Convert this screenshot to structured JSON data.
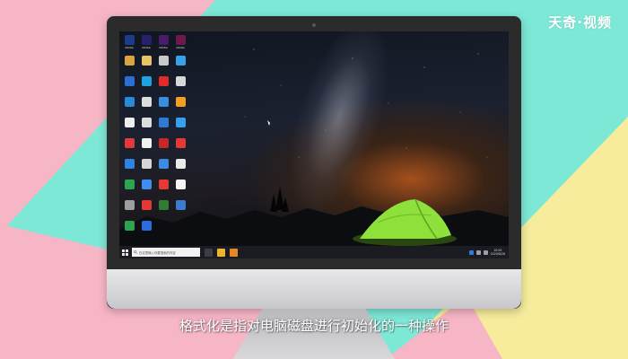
{
  "watermark": "天奇·视频",
  "caption": "格式化是指对电脑磁盘进行初始化的一种操作",
  "desktop_icons": [
    {
      "label": "Adobe",
      "color": "#1f3a8a"
    },
    {
      "label": "Adobe",
      "color": "#2a1f6b"
    },
    {
      "label": "Adobe",
      "color": "#4a1a6b"
    },
    {
      "label": "Adobe",
      "color": "#6b1a4a"
    },
    {
      "label": "",
      "color": "#d9a441"
    },
    {
      "label": "",
      "color": "#e8c36a"
    },
    {
      "label": "",
      "color": "#c9c9c9"
    },
    {
      "label": "",
      "color": "#3aa0e8"
    },
    {
      "label": "",
      "color": "#2b6fd1"
    },
    {
      "label": "",
      "color": "#1fa3e0"
    },
    {
      "label": "",
      "color": "#e02b2b"
    },
    {
      "label": "",
      "color": "#d8d8d8"
    },
    {
      "label": "",
      "color": "#2a88d8"
    },
    {
      "label": "",
      "color": "#dddddd"
    },
    {
      "label": "",
      "color": "#3a8ee0"
    },
    {
      "label": "",
      "color": "#f0a020"
    },
    {
      "label": "",
      "color": "#eeeeee"
    },
    {
      "label": "",
      "color": "#dddddd"
    },
    {
      "label": "",
      "color": "#2f7bd4"
    },
    {
      "label": "",
      "color": "#34a0f0"
    },
    {
      "label": "",
      "color": "#e23a3a"
    },
    {
      "label": "",
      "color": "#f2f2f2"
    },
    {
      "label": "",
      "color": "#c62828"
    },
    {
      "label": "",
      "color": "#e53935"
    },
    {
      "label": "",
      "color": "#2c84e0"
    },
    {
      "label": "",
      "color": "#d7d7d7"
    },
    {
      "label": "",
      "color": "#3d8be0"
    },
    {
      "label": "",
      "color": "#eaeaea"
    },
    {
      "label": "",
      "color": "#2da44e"
    },
    {
      "label": "",
      "color": "#3f8ef0"
    },
    {
      "label": "",
      "color": "#e53935"
    },
    {
      "label": "",
      "color": "#f5f5f5"
    },
    {
      "label": "",
      "color": "#9e9e9e"
    },
    {
      "label": "",
      "color": "#e53935"
    },
    {
      "label": "",
      "color": "#2e7d32"
    },
    {
      "label": "",
      "color": "#3b7bd0"
    },
    {
      "label": "",
      "color": "#2aa44e"
    },
    {
      "label": "",
      "color": "#2d6cdf"
    }
  ],
  "taskbar": {
    "search_placeholder": "在这里输入你要搜索的内容",
    "clock_time": "10:00",
    "clock_date": "2020/6/28"
  },
  "colors": {
    "bg_pink": "#f7b6c6",
    "bg_teal": "#7ee8d6",
    "bg_yellow": "#f6ec9c",
    "tent_green": "#8ee03a"
  }
}
